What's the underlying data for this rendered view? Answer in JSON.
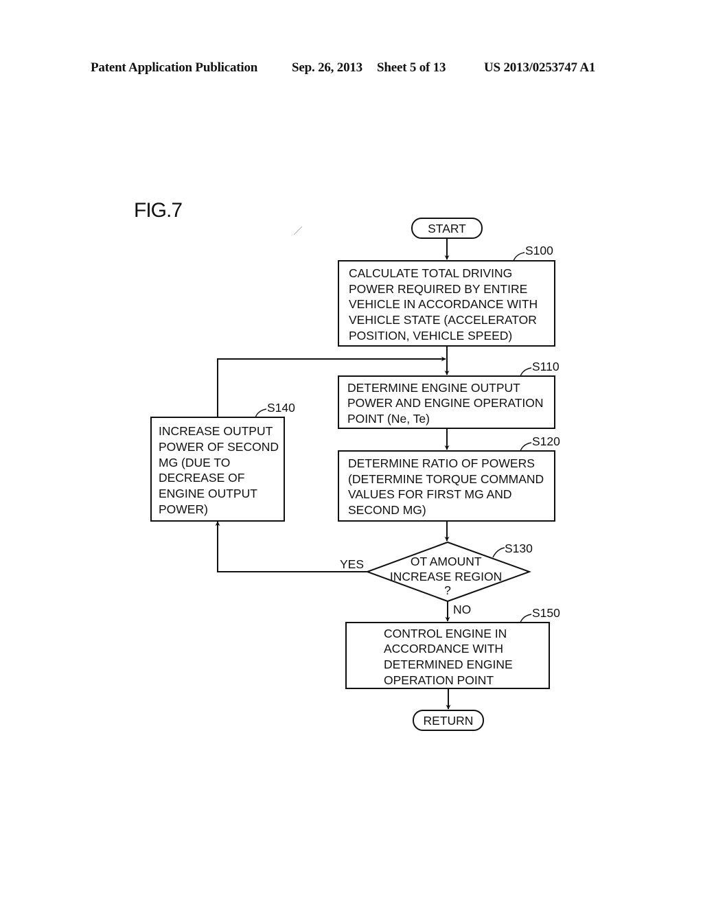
{
  "header": {
    "publication": "Patent Application Publication",
    "date": "Sep. 26, 2013",
    "sheet": "Sheet 5 of 13",
    "number": "US 2013/0253747 A1"
  },
  "figure": {
    "label": "FIG.7"
  },
  "flowchart": {
    "start": "START",
    "end": "RETURN",
    "steps": [
      {
        "id": "S100",
        "lines": [
          "CALCULATE TOTAL DRIVING",
          "POWER REQUIRED BY ENTIRE",
          "VEHICLE IN ACCORDANCE WITH",
          "VEHICLE STATE (ACCELERATOR",
          "POSITION, VEHICLE SPEED)"
        ]
      },
      {
        "id": "S110",
        "lines": [
          "DETERMINE ENGINE OUTPUT",
          "POWER AND ENGINE OPERATION",
          "POINT (Ne, Te)"
        ]
      },
      {
        "id": "S120",
        "lines": [
          "DETERMINE RATIO OF POWERS",
          "(DETERMINE TORQUE COMMAND",
          "VALUES FOR FIRST MG AND",
          "SECOND MG)"
        ]
      },
      {
        "id": "S130",
        "lines": [
          "OT AMOUNT",
          "INCREASE REGION",
          "?"
        ]
      },
      {
        "id": "S140",
        "lines": [
          "INCREASE OUTPUT",
          "POWER OF SECOND",
          "MG (DUE TO",
          "DECREASE OF",
          "ENGINE OUTPUT",
          "POWER)"
        ]
      },
      {
        "id": "S150",
        "lines": [
          "CONTROL ENGINE IN",
          "ACCORDANCE WITH",
          "DETERMINED ENGINE",
          "OPERATION POINT"
        ]
      }
    ],
    "branch_yes": "YES",
    "branch_no": "NO"
  }
}
